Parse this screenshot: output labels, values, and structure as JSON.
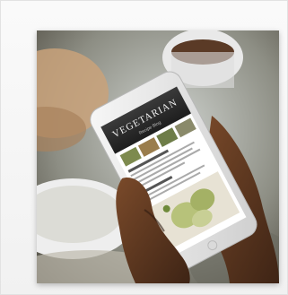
{
  "photo": {
    "subject": "hands-holding-smartphone-recipe",
    "phone_screen": {
      "header_title": "VEGETARIAN",
      "header_subtitle": "Recipe Blog"
    }
  }
}
